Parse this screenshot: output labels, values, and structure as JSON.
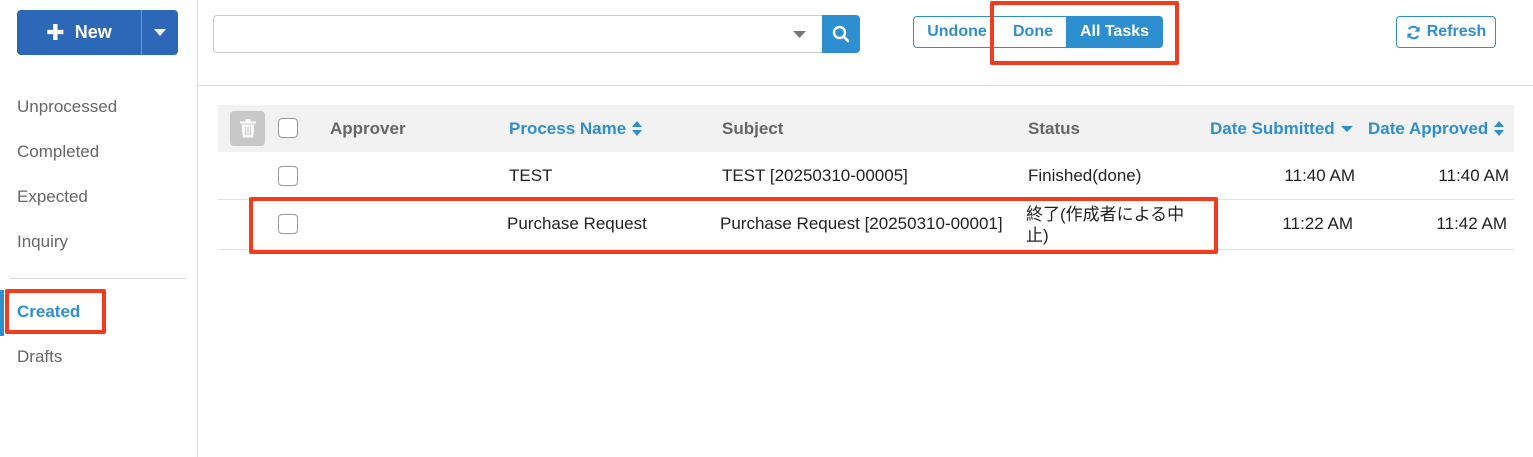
{
  "sidebar": {
    "new_button_label": "New",
    "items": [
      {
        "label": "Unprocessed"
      },
      {
        "label": "Completed"
      },
      {
        "label": "Expected"
      },
      {
        "label": "Inquiry"
      },
      {
        "label": "Created"
      },
      {
        "label": "Drafts"
      }
    ],
    "active_item": "Created"
  },
  "toolbar": {
    "search_value": "",
    "filters": [
      "Undone",
      "Done",
      "All Tasks"
    ],
    "active_filter": "All Tasks",
    "refresh_label": "Refresh"
  },
  "table": {
    "columns": [
      "Approver",
      "Process Name",
      "Subject",
      "Status",
      "Date Submitted",
      "Date Approved"
    ],
    "rows": [
      {
        "approver": "",
        "process_name": "TEST",
        "subject": "TEST [20250310-00005]",
        "status": "Finished(done)",
        "date_submitted": "11:40 AM",
        "date_approved": "11:40 AM"
      },
      {
        "approver": "",
        "process_name": "Purchase Request",
        "subject": "Purchase Request [20250310-00001]",
        "status": "終了(作成者による中止)",
        "date_submitted": "11:22 AM",
        "date_approved": "11:42 AM"
      }
    ]
  },
  "colors": {
    "primary": "#2d8fd0",
    "new_button": "#2d67b8",
    "highlight": "#f33b1e"
  },
  "icons": [
    "plus-icon",
    "caret-down-icon",
    "search-icon",
    "refresh-icon",
    "trash-icon",
    "sort-icon",
    "sort-desc-icon"
  ]
}
